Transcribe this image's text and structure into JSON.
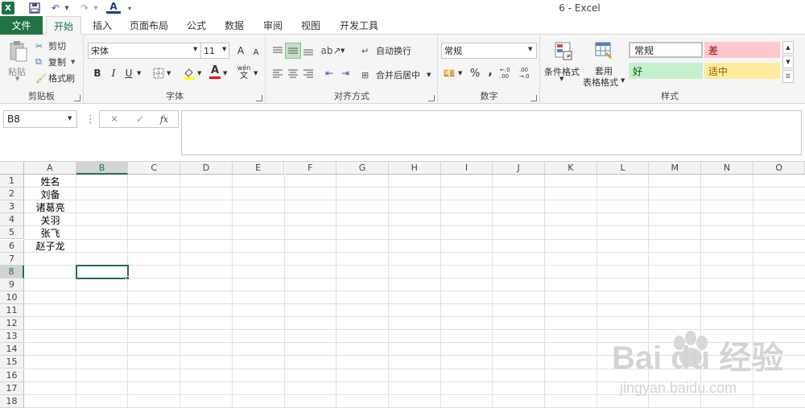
{
  "app": {
    "title": "6 - Excel",
    "logo": "X"
  },
  "quick_access": {
    "save_icon": "floppy-icon",
    "undo_icon": "undo-icon",
    "redo_icon": "redo-icon",
    "font_color_letter": "A"
  },
  "tabs": {
    "file": "文件",
    "items": [
      "开始",
      "插入",
      "页面布局",
      "公式",
      "数据",
      "审阅",
      "视图",
      "开发工具"
    ],
    "active": "开始"
  },
  "ribbon": {
    "clipboard": {
      "paste": "粘贴",
      "cut": "剪切",
      "copy": "复制",
      "format_painter": "格式刷",
      "label": "剪贴板"
    },
    "font": {
      "name": "宋体",
      "size": "11",
      "bold": "B",
      "italic": "I",
      "underline": "U",
      "phonetic_top": "wén",
      "phonetic_bottom": "文",
      "font_color_letter": "A",
      "grow": "A",
      "shrink": "A",
      "label": "字体"
    },
    "alignment": {
      "wrap_text": "自动换行",
      "merge_center": "合并后居中",
      "label": "对齐方式"
    },
    "number": {
      "format": "常规",
      "percent": "%",
      "comma": ",",
      "inc_decimal": "←.0 .00",
      "dec_decimal": ".00 →.0",
      "label": "数字"
    },
    "styles": {
      "conditional_format": "条件格式",
      "format_table_line1": "套用",
      "format_table_line2": "表格格式",
      "normal": "常规",
      "bad": "差",
      "good": "好",
      "neutral": "适中",
      "label": "样式"
    },
    "colors": {
      "accent": "#217346",
      "bad_bg": "#ffc7ce",
      "bad_fg": "#9c0006",
      "good_bg": "#c6efce",
      "good_fg": "#006100",
      "neutral_bg": "#ffeb9c",
      "neutral_fg": "#9c5700"
    }
  },
  "formula_bar": {
    "name_box": "B8",
    "cancel": "✕",
    "enter": "✓",
    "fx": "fx",
    "value": ""
  },
  "sheet": {
    "columns": [
      "A",
      "B",
      "C",
      "D",
      "E",
      "F",
      "G",
      "H",
      "I",
      "J",
      "K",
      "L",
      "M",
      "N",
      "O"
    ],
    "rows": [
      "1",
      "2",
      "3",
      "4",
      "5",
      "6",
      "7",
      "8",
      "9",
      "10",
      "11",
      "12",
      "13",
      "14",
      "15",
      "16",
      "17",
      "18"
    ],
    "selected_column": "B",
    "selected_row": "8",
    "column_a_values": [
      "姓名",
      "刘备",
      "诸葛亮",
      "关羽",
      "张飞",
      "赵子龙"
    ]
  },
  "watermark": {
    "brand": "Bai du 经验",
    "url": "jingyan.baidu.com"
  }
}
